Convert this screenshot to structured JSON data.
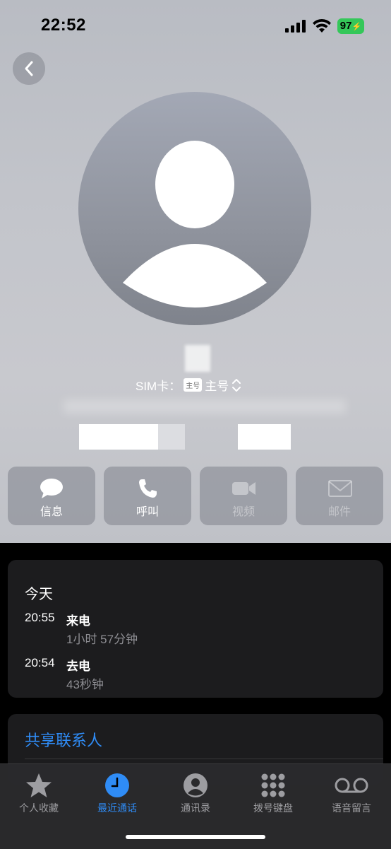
{
  "status": {
    "time": "22:52",
    "battery": "97"
  },
  "contact": {
    "sim_prefix": "SIM卡：",
    "sim_badge": "主号",
    "sim_label": "主号"
  },
  "actions": [
    {
      "label": "信息",
      "icon": "message-icon",
      "enabled": true
    },
    {
      "label": "呼叫",
      "icon": "phone-icon",
      "enabled": true
    },
    {
      "label": "视频",
      "icon": "video-icon",
      "enabled": false
    },
    {
      "label": "邮件",
      "icon": "mail-icon",
      "enabled": false
    }
  ],
  "history": {
    "heading": "今天",
    "calls": [
      {
        "time": "20:55",
        "type": "来电",
        "duration": "1小时 57分钟"
      },
      {
        "time": "20:54",
        "type": "去电",
        "duration": "43秒钟"
      }
    ]
  },
  "share_contact": "共享联系人",
  "tabs": [
    {
      "label": "个人收藏",
      "icon": "star-icon",
      "active": false
    },
    {
      "label": "最近通话",
      "icon": "clock-icon",
      "active": true
    },
    {
      "label": "通讯录",
      "icon": "person-circle-icon",
      "active": false
    },
    {
      "label": "拨号键盘",
      "icon": "keypad-icon",
      "active": false
    },
    {
      "label": "语音留言",
      "icon": "voicemail-icon",
      "active": false
    }
  ],
  "colors": {
    "accent": "#2f8cf6",
    "card": "#1c1c1e",
    "battery": "#34c759"
  }
}
